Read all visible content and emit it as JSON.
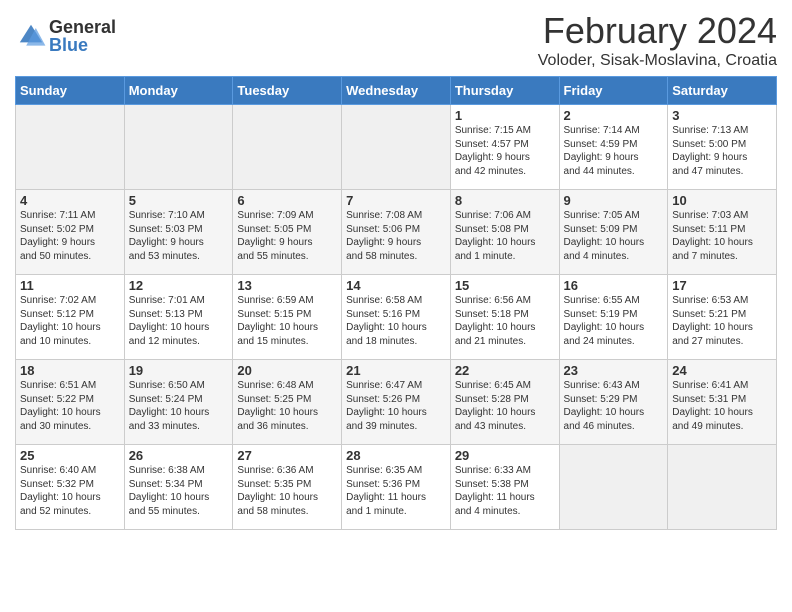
{
  "logo": {
    "general": "General",
    "blue": "Blue"
  },
  "header": {
    "title": "February 2024",
    "subtitle": "Voloder, Sisak-Moslavina, Croatia"
  },
  "days_of_week": [
    "Sunday",
    "Monday",
    "Tuesday",
    "Wednesday",
    "Thursday",
    "Friday",
    "Saturday"
  ],
  "weeks": [
    [
      {
        "day": "",
        "info": ""
      },
      {
        "day": "",
        "info": ""
      },
      {
        "day": "",
        "info": ""
      },
      {
        "day": "",
        "info": ""
      },
      {
        "day": "1",
        "info": "Sunrise: 7:15 AM\nSunset: 4:57 PM\nDaylight: 9 hours\nand 42 minutes."
      },
      {
        "day": "2",
        "info": "Sunrise: 7:14 AM\nSunset: 4:59 PM\nDaylight: 9 hours\nand 44 minutes."
      },
      {
        "day": "3",
        "info": "Sunrise: 7:13 AM\nSunset: 5:00 PM\nDaylight: 9 hours\nand 47 minutes."
      }
    ],
    [
      {
        "day": "4",
        "info": "Sunrise: 7:11 AM\nSunset: 5:02 PM\nDaylight: 9 hours\nand 50 minutes."
      },
      {
        "day": "5",
        "info": "Sunrise: 7:10 AM\nSunset: 5:03 PM\nDaylight: 9 hours\nand 53 minutes."
      },
      {
        "day": "6",
        "info": "Sunrise: 7:09 AM\nSunset: 5:05 PM\nDaylight: 9 hours\nand 55 minutes."
      },
      {
        "day": "7",
        "info": "Sunrise: 7:08 AM\nSunset: 5:06 PM\nDaylight: 9 hours\nand 58 minutes."
      },
      {
        "day": "8",
        "info": "Sunrise: 7:06 AM\nSunset: 5:08 PM\nDaylight: 10 hours\nand 1 minute."
      },
      {
        "day": "9",
        "info": "Sunrise: 7:05 AM\nSunset: 5:09 PM\nDaylight: 10 hours\nand 4 minutes."
      },
      {
        "day": "10",
        "info": "Sunrise: 7:03 AM\nSunset: 5:11 PM\nDaylight: 10 hours\nand 7 minutes."
      }
    ],
    [
      {
        "day": "11",
        "info": "Sunrise: 7:02 AM\nSunset: 5:12 PM\nDaylight: 10 hours\nand 10 minutes."
      },
      {
        "day": "12",
        "info": "Sunrise: 7:01 AM\nSunset: 5:13 PM\nDaylight: 10 hours\nand 12 minutes."
      },
      {
        "day": "13",
        "info": "Sunrise: 6:59 AM\nSunset: 5:15 PM\nDaylight: 10 hours\nand 15 minutes."
      },
      {
        "day": "14",
        "info": "Sunrise: 6:58 AM\nSunset: 5:16 PM\nDaylight: 10 hours\nand 18 minutes."
      },
      {
        "day": "15",
        "info": "Sunrise: 6:56 AM\nSunset: 5:18 PM\nDaylight: 10 hours\nand 21 minutes."
      },
      {
        "day": "16",
        "info": "Sunrise: 6:55 AM\nSunset: 5:19 PM\nDaylight: 10 hours\nand 24 minutes."
      },
      {
        "day": "17",
        "info": "Sunrise: 6:53 AM\nSunset: 5:21 PM\nDaylight: 10 hours\nand 27 minutes."
      }
    ],
    [
      {
        "day": "18",
        "info": "Sunrise: 6:51 AM\nSunset: 5:22 PM\nDaylight: 10 hours\nand 30 minutes."
      },
      {
        "day": "19",
        "info": "Sunrise: 6:50 AM\nSunset: 5:24 PM\nDaylight: 10 hours\nand 33 minutes."
      },
      {
        "day": "20",
        "info": "Sunrise: 6:48 AM\nSunset: 5:25 PM\nDaylight: 10 hours\nand 36 minutes."
      },
      {
        "day": "21",
        "info": "Sunrise: 6:47 AM\nSunset: 5:26 PM\nDaylight: 10 hours\nand 39 minutes."
      },
      {
        "day": "22",
        "info": "Sunrise: 6:45 AM\nSunset: 5:28 PM\nDaylight: 10 hours\nand 43 minutes."
      },
      {
        "day": "23",
        "info": "Sunrise: 6:43 AM\nSunset: 5:29 PM\nDaylight: 10 hours\nand 46 minutes."
      },
      {
        "day": "24",
        "info": "Sunrise: 6:41 AM\nSunset: 5:31 PM\nDaylight: 10 hours\nand 49 minutes."
      }
    ],
    [
      {
        "day": "25",
        "info": "Sunrise: 6:40 AM\nSunset: 5:32 PM\nDaylight: 10 hours\nand 52 minutes."
      },
      {
        "day": "26",
        "info": "Sunrise: 6:38 AM\nSunset: 5:34 PM\nDaylight: 10 hours\nand 55 minutes."
      },
      {
        "day": "27",
        "info": "Sunrise: 6:36 AM\nSunset: 5:35 PM\nDaylight: 10 hours\nand 58 minutes."
      },
      {
        "day": "28",
        "info": "Sunrise: 6:35 AM\nSunset: 5:36 PM\nDaylight: 11 hours\nand 1 minute."
      },
      {
        "day": "29",
        "info": "Sunrise: 6:33 AM\nSunset: 5:38 PM\nDaylight: 11 hours\nand 4 minutes."
      },
      {
        "day": "",
        "info": ""
      },
      {
        "day": "",
        "info": ""
      }
    ]
  ]
}
